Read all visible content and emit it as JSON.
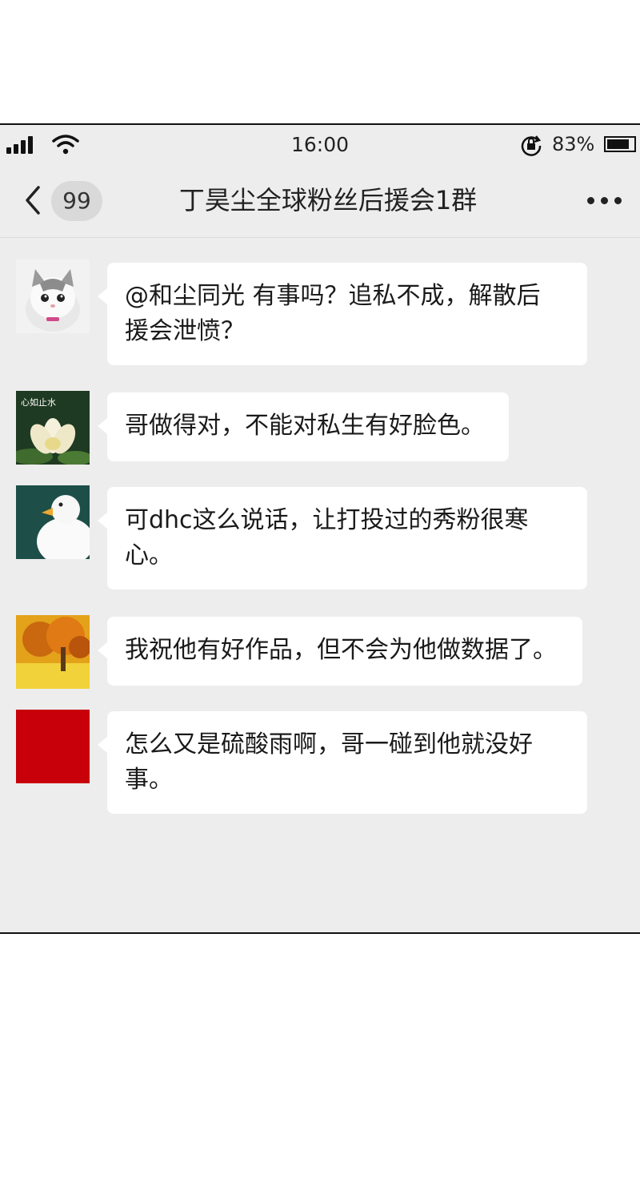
{
  "status_bar": {
    "time": "16:00",
    "battery_percent": "83%",
    "battery_level": 0.83
  },
  "nav": {
    "back_count": "99",
    "title": "丁昊尘全球粉丝后援会1群"
  },
  "messages": [
    {
      "avatar": "cat-photo",
      "text": "@和尘同光 有事吗？追私不成，解散后\n援会泄愤？"
    },
    {
      "avatar": "lotus-photo",
      "avatar_caption": "心如止水",
      "text": "哥做得对，不能对私生有好脸色。"
    },
    {
      "avatar": "duck-photo",
      "text": "可dhc这么说话，让打投过的秀粉很寒\n心。"
    },
    {
      "avatar": "autumn-tree-photo",
      "text": "我祝他有好作品，但不会为他做数据了。"
    },
    {
      "avatar": "red-square",
      "avatar_color": "#c8000a",
      "text": "怎么又是硫酸雨啊，哥一碰到他就没好\n事。"
    }
  ]
}
